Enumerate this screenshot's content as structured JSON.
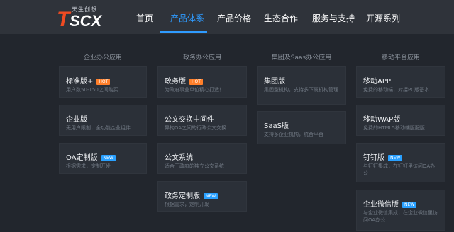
{
  "brand": {
    "logo_text": "TSCX",
    "tagline": "天生创想"
  },
  "nav": {
    "items": [
      {
        "label": "首页"
      },
      {
        "label": "产品体系",
        "active": true
      },
      {
        "label": "产品价格"
      },
      {
        "label": "生态合作"
      },
      {
        "label": "服务与支持"
      },
      {
        "label": "开源系列"
      }
    ]
  },
  "columns": [
    {
      "title": "企业办公应用",
      "cards": [
        {
          "title": "标准版+",
          "badge": "HOT",
          "desc": "用户数50-150之间购买"
        },
        {
          "title": "企业版",
          "desc": "无用户限制，全功能企业组件"
        },
        {
          "title": "OA定制版",
          "badge": "NEW",
          "desc": "根据需求，定制开发"
        }
      ]
    },
    {
      "title": "政务办公应用",
      "cards": [
        {
          "title": "政务版",
          "badge": "HOT",
          "desc": "为政府事业单位精心打造！"
        },
        {
          "title": "公文交换中间件",
          "desc": "异构OA之间的行政公文交换"
        },
        {
          "title": "公文系统",
          "desc": "适合于政府的独立公文系统"
        },
        {
          "title": "政务定制版",
          "badge": "NEW",
          "desc": "根据需求，定制开发"
        }
      ]
    },
    {
      "title": "集团及Saas办公应用",
      "cards": [
        {
          "title": "集团版",
          "desc": "集团型机构，支持多下属机构管理"
        },
        {
          "title": "SaaS版",
          "desc": "支持多企业机构，统合平台"
        }
      ]
    },
    {
      "title": "移动平台应用",
      "cards": [
        {
          "title": "移动APP",
          "desc": "免费的移动端，对接PC版基本"
        },
        {
          "title": "移动WAP版",
          "desc": "免费的HTML5移动端版配版"
        },
        {
          "title": "钉钉版",
          "badge": "NEW",
          "desc": "与钉钉集成，在钉钉里访问OA办公"
        },
        {
          "title": "企业微信版",
          "badge": "NEW",
          "desc": "与企业微信集成，在企业微信里访问OA办公"
        }
      ]
    }
  ],
  "colors": {
    "background": "#22262d",
    "topbar": "#2f333a",
    "accent": "#2f9bff",
    "hot": "#ff7f2a",
    "new": "#29a0ff",
    "logo_red": "#ef4b22"
  }
}
